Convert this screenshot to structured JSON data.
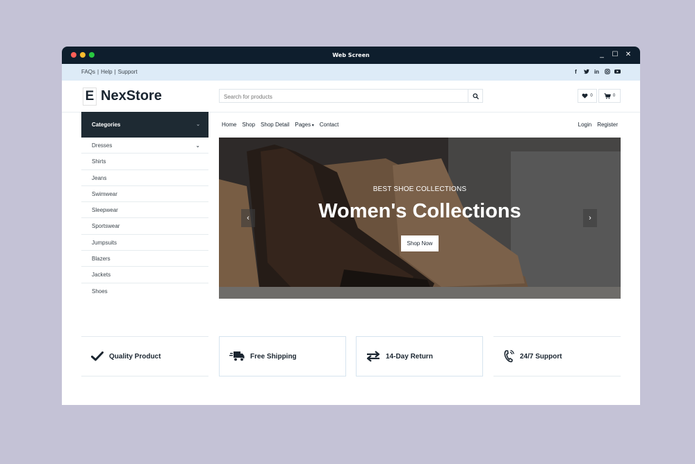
{
  "window": {
    "title": "Web Screen",
    "dots": [
      "#ff5f57",
      "#febc2e",
      "#28c840"
    ]
  },
  "topbar": {
    "links": [
      "FAQs",
      "Help",
      "Support"
    ],
    "social": [
      "facebook-icon",
      "twitter-icon",
      "linkedin-icon",
      "instagram-icon",
      "youtube-icon"
    ]
  },
  "header": {
    "logo_mark": "E",
    "logo_text": "NexStore",
    "search_placeholder": "Search for products",
    "wishlist_count": "0",
    "cart_count": "0"
  },
  "sidebar": {
    "title": "Categories",
    "items": [
      {
        "label": "Dresses",
        "has_children": true
      },
      {
        "label": "Shirts"
      },
      {
        "label": "Jeans"
      },
      {
        "label": "Swimwear"
      },
      {
        "label": "Sleepwear"
      },
      {
        "label": "Sportswear"
      },
      {
        "label": "Jumpsuits"
      },
      {
        "label": "Blazers"
      },
      {
        "label": "Jackets"
      },
      {
        "label": "Shoes"
      }
    ]
  },
  "nav": {
    "items": [
      "Home",
      "Shop",
      "Shop Detail",
      "Pages",
      "Contact"
    ],
    "right": [
      "Login",
      "Register"
    ]
  },
  "hero": {
    "subtitle": "BEST SHOE COLLECTIONS",
    "title": "Women's Collections",
    "button": "Shop Now"
  },
  "features": [
    {
      "label": "Quality Product",
      "icon": "check-icon"
    },
    {
      "label": "Free Shipping",
      "icon": "truck-icon"
    },
    {
      "label": "14-Day Return",
      "icon": "exchange-icon"
    },
    {
      "label": "24/7 Support",
      "icon": "phone-icon"
    }
  ],
  "colors": {
    "dark": "#1e2a33",
    "topbar_bg": "#ddebf7",
    "background": "#c4c2d6",
    "titlebar": "#0e1e2d"
  }
}
